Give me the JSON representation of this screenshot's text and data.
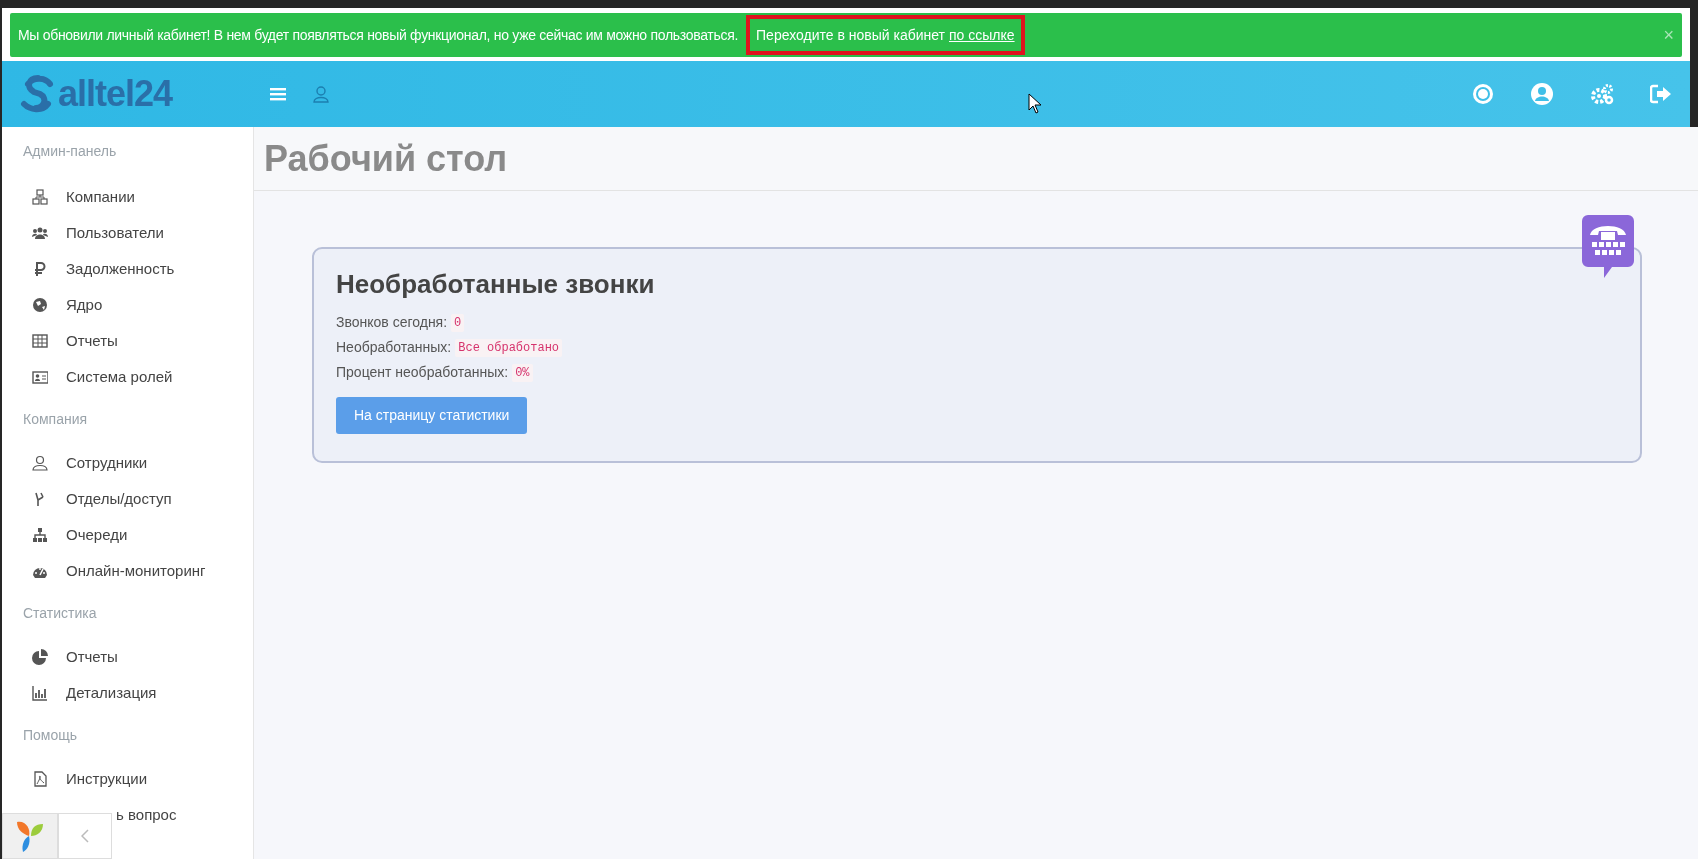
{
  "banner": {
    "message": "Мы обновили личный кабинет! В нем будет появляться новый функционал, но уже сейчас им можно пользоваться.",
    "prompt": "Переходите в новый кабинет",
    "link": "по ссылке",
    "close": "×",
    "highlighted": true
  },
  "header": {
    "logo": "alltel24"
  },
  "sidebar": {
    "sections": [
      {
        "title": "Админ-панель",
        "items": [
          {
            "label": "Компании"
          },
          {
            "label": "Пользователи"
          },
          {
            "label": "Задолженность"
          },
          {
            "label": "Ядро"
          },
          {
            "label": "Отчеты"
          },
          {
            "label": "Система ролей"
          }
        ]
      },
      {
        "title": "Компания",
        "items": [
          {
            "label": "Сотрудники"
          },
          {
            "label": "Отделы/доступ"
          },
          {
            "label": "Очереди"
          },
          {
            "label": "Онлайн-мониторинг"
          }
        ]
      },
      {
        "title": "Статистика",
        "items": [
          {
            "label": "Отчеты"
          },
          {
            "label": "Детализация"
          }
        ]
      },
      {
        "title": "Помощь",
        "items": [
          {
            "label": "Инструкции"
          },
          {
            "label": "ь вопрос"
          }
        ]
      }
    ]
  },
  "page": {
    "title": "Рабочий стол"
  },
  "card": {
    "title": "Необработанные звонки",
    "stats": [
      {
        "label": "Звонков сегодня:",
        "value": "0"
      },
      {
        "label": "Необработанных:",
        "value": "Все обработано"
      },
      {
        "label": "Процент необработанных:",
        "value": "0%"
      }
    ],
    "button": "На страницу статистики"
  }
}
